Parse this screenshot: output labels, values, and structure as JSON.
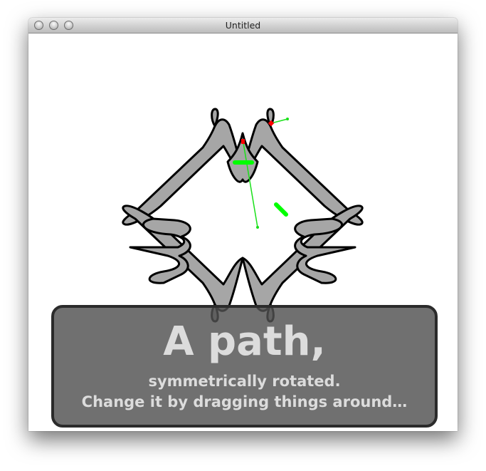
{
  "window": {
    "title": "Untitled"
  },
  "overlay": {
    "title": "A path,",
    "subtitle": "symmetrically rotated.",
    "instruction": "Change it by dragging things around…"
  },
  "colors": {
    "path_fill": "#a6a6a6",
    "path_stroke": "#000000",
    "handle_line": "#19e019",
    "handle_bar": "#00ff00",
    "anchor_point": "#ff0000",
    "overlay_bg": "#505050",
    "overlay_text": "#dcdcdc"
  }
}
